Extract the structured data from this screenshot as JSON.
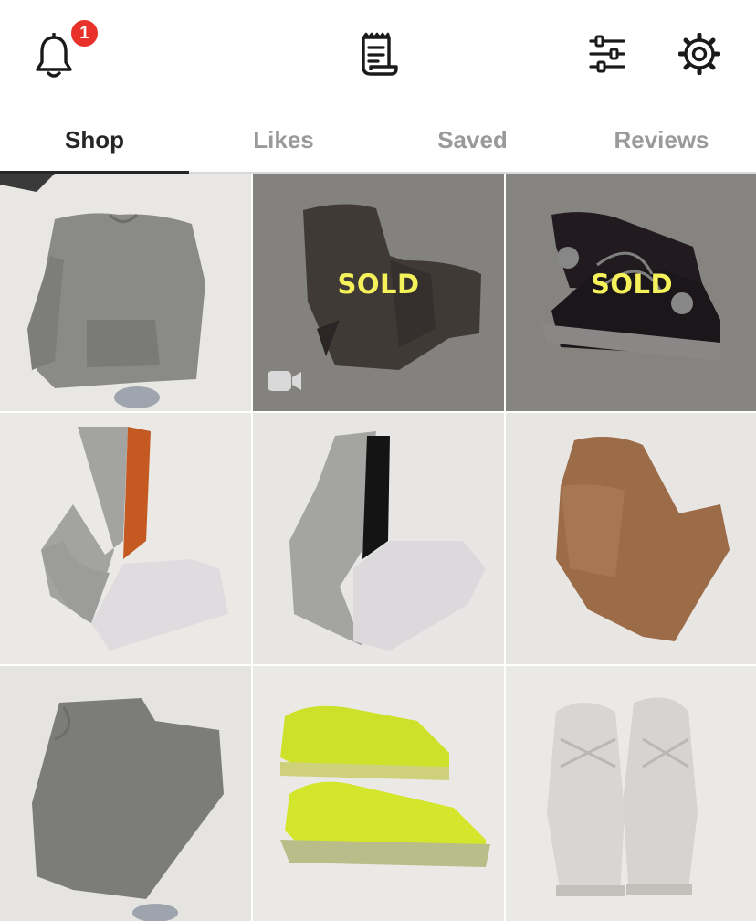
{
  "header": {
    "notification_count": "1",
    "icons": [
      "bell-icon",
      "receipt-icon",
      "sliders-icon",
      "gear-icon"
    ]
  },
  "tabs": [
    {
      "label": "Shop",
      "active": true
    },
    {
      "label": "Likes",
      "active": false
    },
    {
      "label": "Saved",
      "active": false
    },
    {
      "label": "Reviews",
      "active": false
    }
  ],
  "items": [
    {
      "item": "grey hoodie",
      "sold": false
    },
    {
      "item": "grey distressed cargo pants",
      "sold": true,
      "sold_label": "SOLD",
      "has_video": true
    },
    {
      "item": "black high-top sneakers",
      "sold": true,
      "sold_label": "SOLD"
    },
    {
      "item": "grey orange and white colorblock joggers",
      "sold": false
    },
    {
      "item": "grey black and white colorblock joggers",
      "sold": false
    },
    {
      "item": "brown fleece joggers",
      "sold": false
    },
    {
      "item": "grey sweatpants",
      "sold": false
    },
    {
      "item": "neon yellow patent sneakers",
      "sold": false
    },
    {
      "item": "white low-top sneakers",
      "sold": false
    }
  ],
  "colors": {
    "badge": "#e8312a",
    "sold_text": "#f4f15a",
    "tab_active": "#262626",
    "tab_inactive": "#9a9a9a"
  }
}
